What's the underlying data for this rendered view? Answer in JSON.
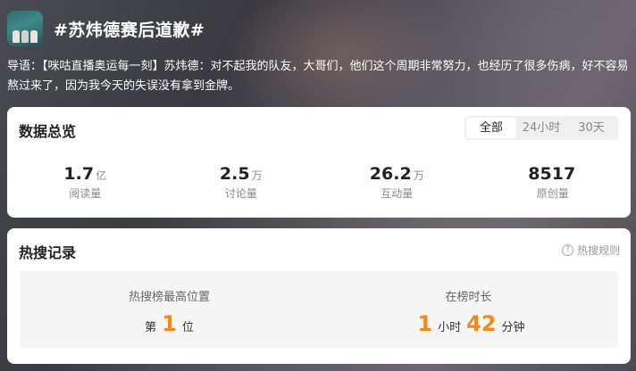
{
  "topic": {
    "title": "#苏炜德赛后道歉#",
    "thumbnail_icon": "thumbnail-image"
  },
  "intro": "导语：【咪咕直播奥运每一刻】苏炜德：对不起我的队友，大哥们，他们这个周期非常努力，也经历了很多伤病，好不容易熬过来了，因为我今天的失误没有拿到金牌。",
  "overview": {
    "title": "数据总览",
    "tabs": [
      "全部",
      "24小时",
      "30天"
    ],
    "active_tab": "全部",
    "stats": [
      {
        "value": "1.7",
        "unit": "亿",
        "label": "阅读量"
      },
      {
        "value": "2.5",
        "unit": "万",
        "label": "讨论量"
      },
      {
        "value": "26.2",
        "unit": "万",
        "label": "互动量"
      },
      {
        "value": "8517",
        "unit": "",
        "label": "原创量"
      }
    ]
  },
  "hot": {
    "title": "热搜记录",
    "rules_label": "热搜规则",
    "rules_icon": "question-circle-icon",
    "top_position": {
      "label": "热搜榜最高位置",
      "prefix": "第",
      "value": "1",
      "suffix": "位"
    },
    "duration": {
      "label": "在榜时长",
      "hours": "1",
      "hours_unit": "小时",
      "minutes": "42",
      "minutes_unit": "分钟"
    }
  },
  "colors": {
    "accent_orange": "#f08a1c"
  }
}
